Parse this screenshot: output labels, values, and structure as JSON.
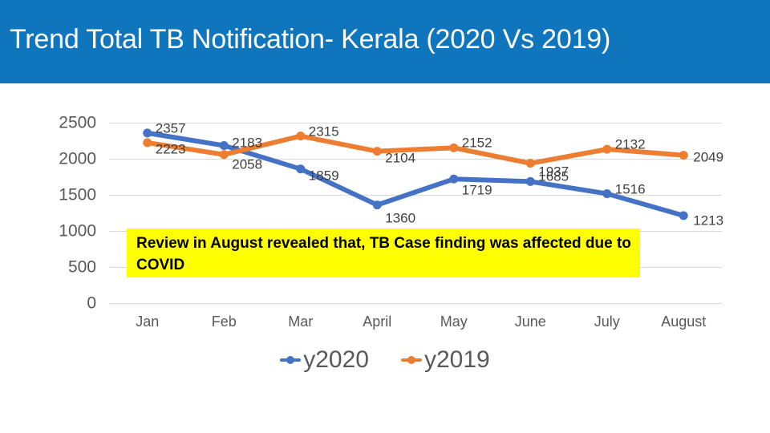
{
  "header": {
    "title": "Trend Total TB Notification- Kerala (2020 Vs 2019)",
    "background_color": "#0f76bd",
    "text_color": "#ffffff"
  },
  "annotation": {
    "text": "Review in August revealed that, TB Case finding was affected due to COVID",
    "background_color": "#ffff00",
    "text_color": "#000000"
  },
  "legend": {
    "position": "bottom-center",
    "entries": [
      {
        "label": "y2020",
        "color": "#4472c4"
      },
      {
        "label": "y2019",
        "color": "#ed7d31"
      }
    ]
  },
  "chart_data": {
    "type": "line",
    "title": "Trend Total TB Notification- Kerala (2020 Vs 2019)",
    "xlabel": "",
    "ylabel": "",
    "categories": [
      "Jan",
      "Feb",
      "Mar",
      "April",
      "May",
      "June",
      "July",
      "August"
    ],
    "yticks": [
      0,
      500,
      1000,
      1500,
      2000,
      2500
    ],
    "ylim": [
      0,
      2500
    ],
    "grid": true,
    "series": [
      {
        "name": "y2020",
        "color": "#4472c4",
        "values": [
          2357,
          2183,
          1859,
          1360,
          1719,
          1685,
          1516,
          1213
        ]
      },
      {
        "name": "y2019",
        "color": "#ed7d31",
        "values": [
          2223,
          2058,
          2315,
          2104,
          2152,
          1937,
          2132,
          2049
        ]
      }
    ],
    "annotations": [
      "Review in August revealed that, TB Case finding was affected due to COVID"
    ]
  }
}
